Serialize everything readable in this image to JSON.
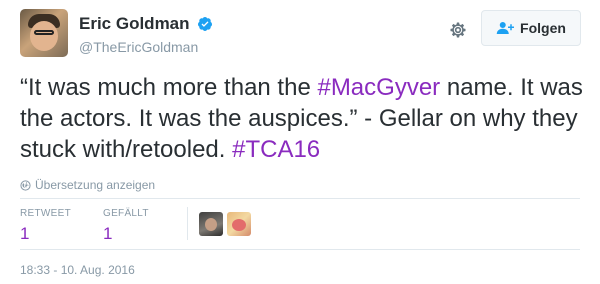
{
  "user": {
    "display_name": "Eric Goldman",
    "handle": "@TheEricGoldman",
    "verified": true
  },
  "header": {
    "follow_label": "Folgen"
  },
  "tweet": {
    "segments": [
      {
        "text": "“It was much more than the ",
        "type": "text"
      },
      {
        "text": "#MacGyver",
        "type": "hashtag"
      },
      {
        "text": " name. It was the actors. It was the auspices.” - Gellar on why they stuck with/retooled. ",
        "type": "text"
      },
      {
        "text": "#TCA16",
        "type": "hashtag"
      }
    ],
    "translate_label": "Übersetzung anzeigen"
  },
  "stats": {
    "retweets_label": "RETWEET",
    "retweets_value": "1",
    "likes_label": "GEFÄLLT",
    "likes_value": "1"
  },
  "timestamp": "18:33 - 10. Aug. 2016",
  "colors": {
    "link": "#8a2bbf",
    "verified": "#1da1f2",
    "muted": "#8899a6"
  },
  "icons": [
    "verified-badge-icon",
    "gear-icon",
    "follow-person-icon",
    "globe-icon"
  ]
}
